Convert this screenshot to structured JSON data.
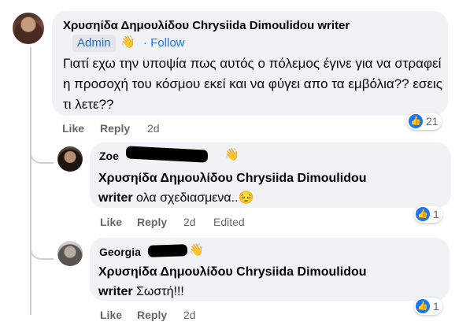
{
  "comments": [
    {
      "author": "Χρυσηίδα Δημουλίδου Chrysiida Dimoulidou writer",
      "badge": "Admin",
      "follow": "· Follow",
      "text": "Γιατί εχω την υποψία πως αυτός ο πόλεμος έγινε για να στραφεί η προσοχή του κόσμου εκεί και να φύγει απο τα εμβόλια?? εσεις τι λετε??",
      "like": "Like",
      "reply": "Reply",
      "time": "2d",
      "reaction_count": "21"
    },
    {
      "author": "Zoe",
      "mention_line1": "Χρυσηίδα Δημουλίδου Chrysiida Dimoulidou",
      "mention_line2": "writer",
      "text": " ολα σχεδιασμενα..",
      "emoji": "😔",
      "like": "Like",
      "reply": "Reply",
      "time": "2d",
      "edited": "Edited",
      "reaction_count": "1"
    },
    {
      "author": "Georgia",
      "mention_line1": "Χρυσηίδα Δημουλίδου Chrysiida Dimoulidou",
      "mention_line2": "writer",
      "text": " Σωστή!!!",
      "like": "Like",
      "reply": "Reply",
      "time": "2d",
      "reaction_count": "1"
    }
  ],
  "icons": {
    "wave": "👋",
    "like": "👍"
  },
  "colors": {
    "bubble": "#f0f2f5",
    "link": "#1877f2",
    "meta": "#65676b"
  }
}
